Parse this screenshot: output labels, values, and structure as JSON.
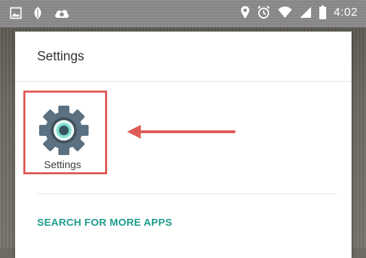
{
  "status_bar": {
    "time": "4:02",
    "left_icons": [
      "image-icon",
      "leaf-icon",
      "cloud-icon"
    ],
    "right_icons": [
      "location-icon",
      "alarm-icon",
      "wifi-icon",
      "signal-icon",
      "battery-icon"
    ]
  },
  "sheet": {
    "title": "Settings",
    "apps": [
      {
        "label": "Settings",
        "icon": "gear-icon"
      }
    ],
    "search_more_label": "SEARCH FOR MORE APPS"
  },
  "colors": {
    "highlight": "#e05a56",
    "accent": "#1e9c8c",
    "gear": "#5b7080",
    "gear_center": "#7ee0d0"
  }
}
